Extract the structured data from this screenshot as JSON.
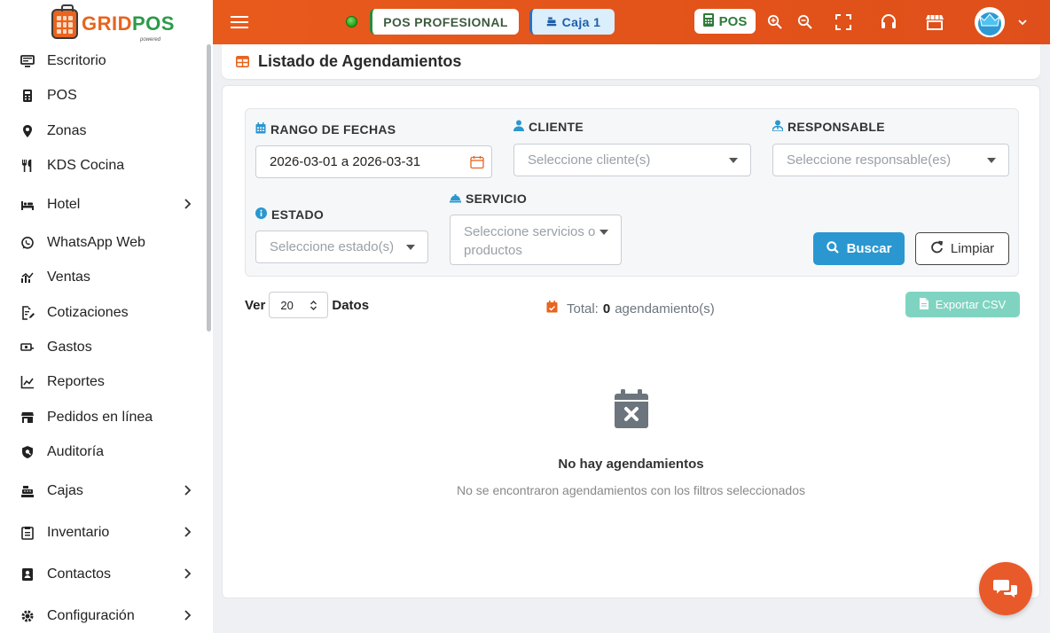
{
  "app": {
    "logo_text_a": "GRID",
    "logo_text_b": "POS",
    "logo_sub": "powered"
  },
  "sidebar": {
    "items": [
      {
        "label": "Escritorio",
        "icon": "desktop-icon",
        "has_arrow": false
      },
      {
        "label": "POS",
        "icon": "pos-icon",
        "has_arrow": false
      },
      {
        "label": "Zonas",
        "icon": "map-pin-icon",
        "has_arrow": false
      },
      {
        "label": "KDS Cocina",
        "icon": "utensils-icon",
        "has_arrow": false
      },
      {
        "label": "Hotel",
        "icon": "bed-icon",
        "has_arrow": true
      },
      {
        "label": "WhatsApp Web",
        "icon": "whatsapp-icon",
        "has_arrow": false
      },
      {
        "label": "Ventas",
        "icon": "sales-chart-icon",
        "has_arrow": false
      },
      {
        "label": "Cotizaciones",
        "icon": "quote-edit-icon",
        "has_arrow": false
      },
      {
        "label": "Gastos",
        "icon": "money-icon",
        "has_arrow": false
      },
      {
        "label": "Reportes",
        "icon": "line-chart-icon",
        "has_arrow": false
      },
      {
        "label": "Pedidos en línea",
        "icon": "store-icon",
        "has_arrow": false
      },
      {
        "label": "Auditoría",
        "icon": "shield-icon",
        "has_arrow": false
      },
      {
        "label": "Cajas",
        "icon": "cash-register-icon",
        "has_arrow": true
      },
      {
        "label": "Inventario",
        "icon": "clipboard-icon",
        "has_arrow": true
      },
      {
        "label": "Contactos",
        "icon": "contacts-icon",
        "has_arrow": true
      },
      {
        "label": "Configuración",
        "icon": "gear-icon",
        "has_arrow": true
      }
    ]
  },
  "topbar": {
    "plan_label": "POS PROFESIONAL",
    "caja_label": "Caja 1",
    "pos_button": "POS",
    "status_color": "#1e9e1e"
  },
  "header": {
    "title": "Listado de Agendamientos"
  },
  "filters": {
    "rango_label": "RANGO DE FECHAS",
    "rango_value": "2026-03-01 a 2026-03-31",
    "cliente_label": "CLIENTE",
    "cliente_placeholder": "Seleccione cliente(s)",
    "responsable_label": "RESPONSABLE",
    "responsable_placeholder": "Seleccione responsable(es)",
    "estado_label": "ESTADO",
    "estado_placeholder": "Seleccione estado(s)",
    "servicio_label": "SERVICIO",
    "servicio_placeholder_1": "Seleccione servicios o",
    "servicio_placeholder_2": "productos",
    "buscar": "Buscar",
    "limpiar": "Limpiar"
  },
  "table_controls": {
    "ver": "Ver",
    "page_size": "20",
    "datos": "Datos",
    "total_prefix": "Total:",
    "total_count": "0",
    "total_suffix": "agendamiento(s)",
    "export": "Exportar CSV"
  },
  "empty": {
    "title": "No hay agendamientos",
    "subtitle": "No se encontraron agendamientos con los filtros seleccionados"
  },
  "colors": {
    "brand": "#e85a1c",
    "primary_button": "#2a97d0",
    "export_button": "#7fd4c1"
  }
}
